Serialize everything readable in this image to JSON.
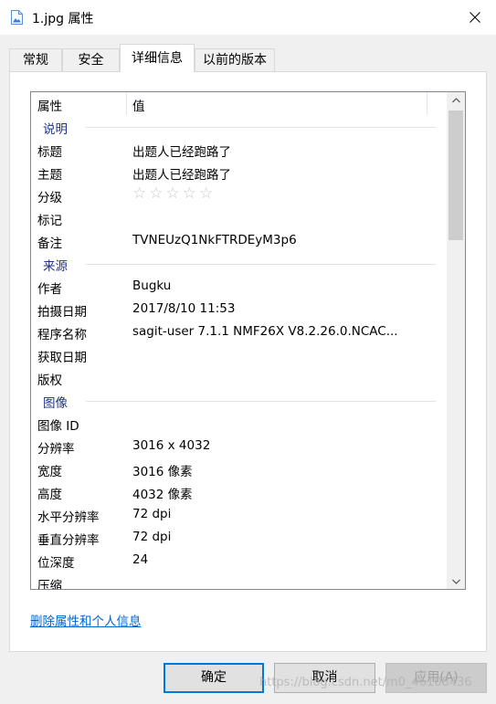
{
  "window": {
    "title": "1.jpg 属性",
    "icon": "image-file-icon",
    "close_icon": "close-icon"
  },
  "tabs": [
    {
      "label": "常规",
      "active": false
    },
    {
      "label": "安全",
      "active": false
    },
    {
      "label": "详细信息",
      "active": true
    },
    {
      "label": "以前的版本",
      "active": false
    }
  ],
  "details": {
    "columns": {
      "property": "属性",
      "value": "值"
    },
    "groups": {
      "description": {
        "label": "说明",
        "rows": [
          {
            "name": "标题",
            "value": "出题人已经跑路了"
          },
          {
            "name": "主题",
            "value": "出题人已经跑路了"
          },
          {
            "name": "分级",
            "rating": 0,
            "rating_max": 5,
            "stars": "☆☆☆☆☆"
          },
          {
            "name": "标记",
            "value": ""
          },
          {
            "name": "备注",
            "value": "TVNEUzQ1NkFTRDEyM3p6"
          }
        ]
      },
      "origin": {
        "label": "来源",
        "rows": [
          {
            "name": "作者",
            "value": "Bugku"
          },
          {
            "name": "拍摄日期",
            "value": "2017/8/10 11:53"
          },
          {
            "name": "程序名称",
            "value": "sagit-user 7.1.1 NMF26X V8.2.26.0.NCAC..."
          },
          {
            "name": "获取日期",
            "value": ""
          },
          {
            "name": "版权",
            "value": ""
          }
        ]
      },
      "image": {
        "label": "图像",
        "rows": [
          {
            "name": "图像 ID",
            "value": ""
          },
          {
            "name": "分辨率",
            "value": "3016 x 4032"
          },
          {
            "name": "宽度",
            "value": "3016 像素"
          },
          {
            "name": "高度",
            "value": "4032 像素"
          },
          {
            "name": "水平分辨率",
            "value": "72 dpi"
          },
          {
            "name": "垂直分辨率",
            "value": "72 dpi"
          },
          {
            "name": "位深度",
            "value": "24"
          },
          {
            "name": "压缩",
            "value": ""
          }
        ]
      }
    }
  },
  "remove_link": "删除属性和个人信息",
  "buttons": {
    "ok": "确定",
    "cancel": "取消",
    "apply": "应用(A)"
  },
  "watermark": "https://blog.csdn.net/m0_46108436",
  "colors": {
    "group_header": "#1e3287",
    "link": "#0066cc",
    "focus_border": "#0078d7"
  }
}
